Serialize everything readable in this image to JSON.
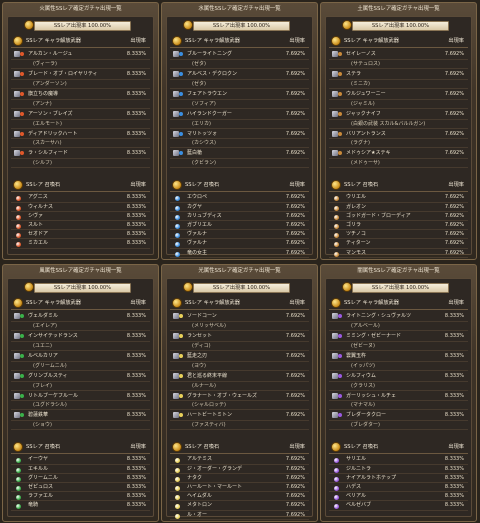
{
  "rate_header": "出現率",
  "ss_rate": "SSレア出現率 100.00%",
  "ss_rate_panel1": "SSレア出現率 100.00%",
  "weapon_section": "SSレア キャラ解放武器",
  "summon_section": "SSレア 召喚石",
  "panels": [
    {
      "title": "火属性SSレア確定ガチャ出現一覧",
      "accent": "#e0582a",
      "weapons": [
        {
          "name": "アルカン・ルージュ",
          "rate": "8.333%",
          "sub": "(ヴィーラ)"
        },
        {
          "name": "ブレード・オブ・ロイヤリティ",
          "rate": "8.333%",
          "sub": "(アンダーソン)"
        },
        {
          "name": "旗立ちの魔導",
          "rate": "8.333%",
          "sub": "(アンナ)"
        },
        {
          "name": "アーソン・ブレイズ",
          "rate": "8.333%",
          "sub": "(エルモート)"
        },
        {
          "name": "ディアドリックハート",
          "rate": "8.333%",
          "sub": "(スカーサハ)"
        },
        {
          "name": "ラ・シルフィード",
          "rate": "8.333%",
          "sub": "(シルフ)"
        }
      ],
      "summons": [
        {
          "name": "アグニス",
          "rate": "8.333%"
        },
        {
          "name": "ウィルナス",
          "rate": "8.333%"
        },
        {
          "name": "シヴァ",
          "rate": "8.333%"
        },
        {
          "name": "スルト",
          "rate": "8.333%"
        },
        {
          "name": "セオドア",
          "rate": "8.333%"
        },
        {
          "name": "ミカエル",
          "rate": "8.333%"
        }
      ]
    },
    {
      "title": "水属性SSレア確定ガチャ出現一覧",
      "accent": "#3a8ee0",
      "weapons": [
        {
          "name": "ブルーライトニング",
          "rate": "7.692%",
          "sub": "(ゼタ)"
        },
        {
          "name": "アルベス・デクロクン",
          "rate": "7.692%",
          "sub": "(ゼタ)"
        },
        {
          "name": "フェアトラウエン",
          "rate": "7.692%",
          "sub": "(ソフィア)"
        },
        {
          "name": "ハイランドクーガー",
          "rate": "7.692%",
          "sub": "(エリカ)"
        },
        {
          "name": "マリトッツォ",
          "rate": "7.692%",
          "sub": "(カシウス)"
        },
        {
          "name": "藍白槍",
          "rate": "7.692%",
          "sub": "(クビラン)"
        }
      ],
      "summons": [
        {
          "name": "エウロペ",
          "rate": "7.692%"
        },
        {
          "name": "カグヤ",
          "rate": "7.692%"
        },
        {
          "name": "カリュブディス",
          "rate": "7.692%"
        },
        {
          "name": "ガブリエル",
          "rate": "7.692%"
        },
        {
          "name": "ヴァルナ",
          "rate": "7.692%"
        },
        {
          "name": "ヴァルナ",
          "rate": "7.692%"
        },
        {
          "name": "竜の女主",
          "rate": "7.692%"
        }
      ]
    },
    {
      "title": "土属性SSレア確定ガチャ出現一覧",
      "accent": "#c98a3a",
      "weapons": [
        {
          "name": "セイレーノス",
          "rate": "7.692%",
          "sub": "(サテュロス)"
        },
        {
          "name": "ステラ",
          "rate": "7.692%",
          "sub": "(ミニカ)"
        },
        {
          "name": "ウルジュワーニー",
          "rate": "7.692%",
          "sub": "(ジャミル)"
        },
        {
          "name": "ジャックナイフ",
          "rate": "7.692%",
          "sub": "(白銀の武装 スカル&バルルガン)"
        },
        {
          "name": "バリアントランス",
          "rate": "7.692%",
          "sub": "(ラグナ)"
        },
        {
          "name": "メドゥシア★ステキ",
          "rate": "7.692%",
          "sub": "(メドゥーサ)"
        }
      ],
      "summons": [
        {
          "name": "ウリエル",
          "rate": "7.692%"
        },
        {
          "name": "ガレオン",
          "rate": "7.692%"
        },
        {
          "name": "ゴッドガード・ブローディア",
          "rate": "7.692%"
        },
        {
          "name": "ゴリラ",
          "rate": "7.692%"
        },
        {
          "name": "ツチノコ",
          "rate": "7.692%"
        },
        {
          "name": "ティターン",
          "rate": "7.692%"
        },
        {
          "name": "マンモス",
          "rate": "7.692%"
        }
      ]
    },
    {
      "title": "風属性SSレア確定ガチャ出現一覧",
      "accent": "#3ab04a",
      "weapons": [
        {
          "name": "ヴェルダミル",
          "rate": "8.333%",
          "sub": "(エイレア)"
        },
        {
          "name": "インサイテッドランス",
          "rate": "8.333%",
          "sub": "(ユエニ)"
        },
        {
          "name": "ルベルカリア",
          "rate": "8.333%",
          "sub": "(グリームニル)"
        },
        {
          "name": "グリンブルスティ",
          "rate": "8.333%",
          "sub": "(フレイ)"
        },
        {
          "name": "リトルブーケフルール",
          "rate": "8.333%",
          "sub": "(ユグドラシル)"
        },
        {
          "name": "碧蓮鉄華",
          "rate": "8.333%",
          "sub": "(ショウ)"
        }
      ],
      "summons": [
        {
          "name": "イーウヤ",
          "rate": "8.333%"
        },
        {
          "name": "エキルル",
          "rate": "8.333%"
        },
        {
          "name": "グリームニル",
          "rate": "8.333%"
        },
        {
          "name": "ゼピュロス",
          "rate": "8.333%"
        },
        {
          "name": "ラファエル",
          "rate": "8.333%"
        },
        {
          "name": "竜騎",
          "rate": "8.333%"
        }
      ]
    },
    {
      "title": "光属性SSレア確定ガチャ出現一覧",
      "accent": "#e8d05a",
      "weapons": [
        {
          "name": "ソードコーン",
          "rate": "7.692%",
          "sub": "(メリッサベル)"
        },
        {
          "name": "ランセット",
          "rate": "7.692%",
          "sub": "(ディコ)"
        },
        {
          "name": "藍走之刃",
          "rate": "7.692%",
          "sub": "(ヨウ)"
        },
        {
          "name": "君と巡る終末平線",
          "rate": "7.692%",
          "sub": "(ルナール)"
        },
        {
          "name": "グラナート・オブ・ウェールズ",
          "rate": "7.692%",
          "sub": "(シャルロッテ)"
        },
        {
          "name": "ハートビートミトン",
          "rate": "7.692%",
          "sub": "(ファスティバ)"
        }
      ],
      "summons": [
        {
          "name": "アルテミス",
          "rate": "7.692%"
        },
        {
          "name": "ジ・オーダー・グランデ",
          "rate": "7.692%"
        },
        {
          "name": "ナタク",
          "rate": "7.692%"
        },
        {
          "name": "ハールート・マールート",
          "rate": "7.692%"
        },
        {
          "name": "ヘイムダル",
          "rate": "7.692%"
        },
        {
          "name": "メタトロン",
          "rate": "7.692%"
        },
        {
          "name": "ル・オー",
          "rate": "7.692%"
        }
      ]
    },
    {
      "title": "闇属性SSレア確定ガチャ出現一覧",
      "accent": "#9a5ae0",
      "weapons": [
        {
          "name": "ライトニング・シュヴァルツ",
          "rate": "8.333%",
          "sub": "(アルベール)"
        },
        {
          "name": "ミミング・ゼビーナード",
          "rate": "8.333%",
          "sub": "(ゼビーヌ)"
        },
        {
          "name": "雲翼玉杵",
          "rate": "8.333%",
          "sub": "(イッパツ)"
        },
        {
          "name": "シルフィウム",
          "rate": "8.333%",
          "sub": "(クラリス)"
        },
        {
          "name": "ガーリッシュ・ルチェ",
          "rate": "8.333%",
          "sub": "(マナマル)"
        },
        {
          "name": "ブレダータクロー",
          "rate": "8.333%",
          "sub": "(ブレダター)"
        }
      ],
      "summons": [
        {
          "name": "サリエル",
          "rate": "8.333%"
        },
        {
          "name": "ジルニトラ",
          "rate": "8.333%"
        },
        {
          "name": "ナイアルラトホテップ",
          "rate": "8.333%"
        },
        {
          "name": "ハデス",
          "rate": "8.333%"
        },
        {
          "name": "ベリアル",
          "rate": "8.333%"
        },
        {
          "name": "ベルゼバブ",
          "rate": "8.333%"
        }
      ]
    }
  ]
}
